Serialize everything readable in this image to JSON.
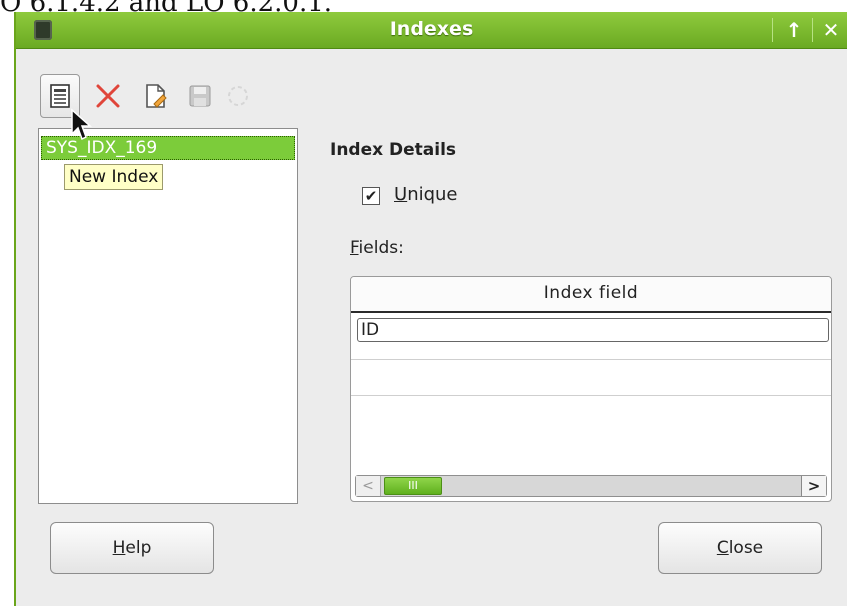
{
  "background_caption": "O 6.1.4.2 and LO 6.2.0.1.",
  "window": {
    "title": "Indexes",
    "titlebar_buttons": {
      "up_glyph": "↑",
      "close_glyph": "✕"
    }
  },
  "toolbar": {
    "tools": [
      {
        "name": "new-index",
        "icon": "document-list-icon"
      },
      {
        "name": "delete-index",
        "icon": "delete-x-icon"
      },
      {
        "name": "rename-index",
        "icon": "rename-page-icon"
      },
      {
        "name": "save-index",
        "icon": "floppy-save-icon"
      },
      {
        "name": "reset-index",
        "icon": "circle-reset-icon"
      }
    ]
  },
  "index_list": {
    "items": [
      "SYS_IDX_169"
    ],
    "tooltip": "New Index"
  },
  "details": {
    "section_title": "Index Details",
    "unique_label": "Unique",
    "unique_checked": true,
    "fields_label": "Fields:",
    "grid": {
      "column_header": "Index field",
      "rows": [
        "ID"
      ],
      "scroll_thumb_glyph": "III",
      "scroll_right_glyph": ">",
      "scroll_left_glyph": "<"
    }
  },
  "buttons": {
    "help": "Help",
    "close": "Close"
  },
  "colors": {
    "accent": "#7ccc3a",
    "titlebar": "#6aaa22",
    "delete_red": "#e0453a"
  }
}
